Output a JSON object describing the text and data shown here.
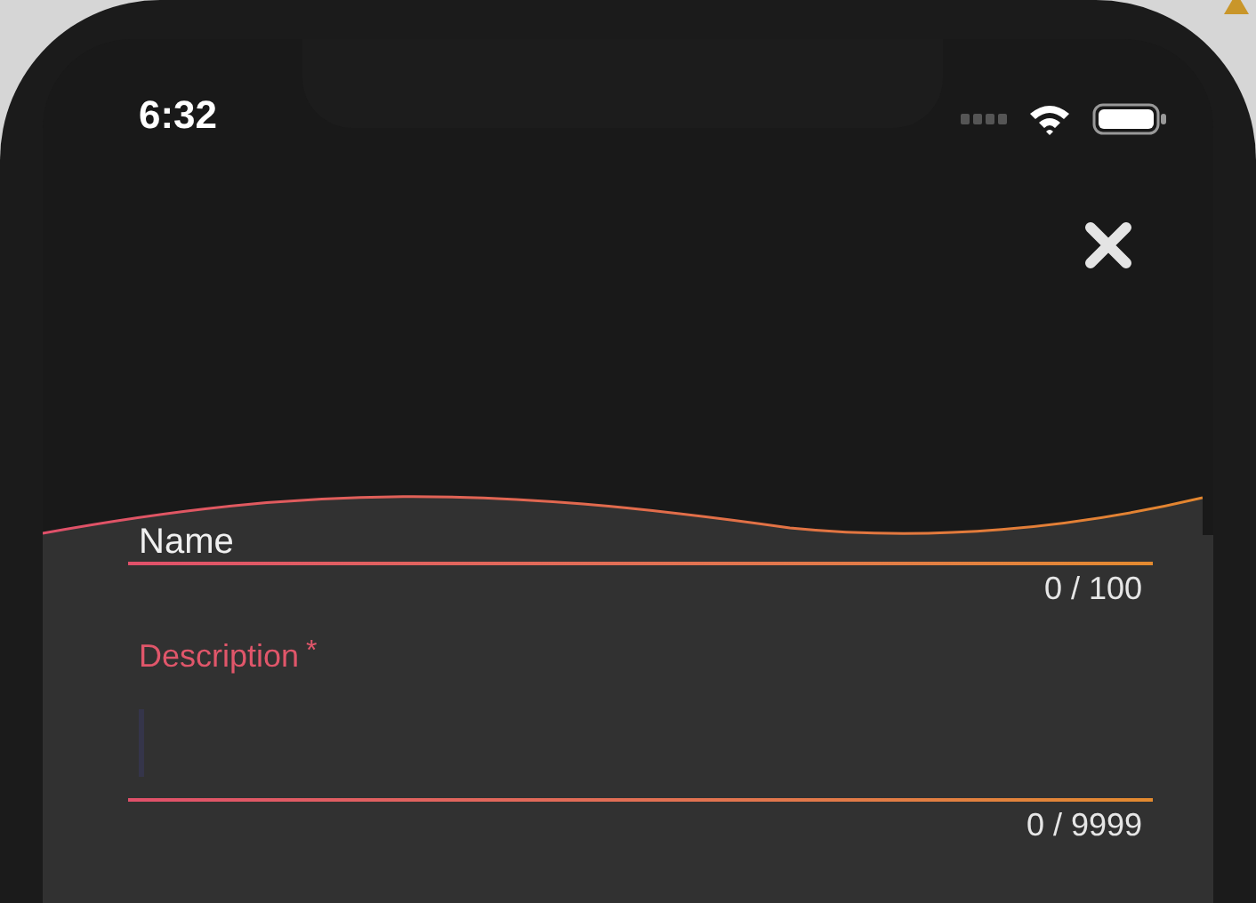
{
  "status_bar": {
    "time": "6:32"
  },
  "fields": [
    {
      "label": "Name",
      "focused": false,
      "counter": "0 / 100"
    },
    {
      "label": "Description",
      "required_mark": "*",
      "focused": true,
      "counter": "0 / 9999"
    }
  ]
}
